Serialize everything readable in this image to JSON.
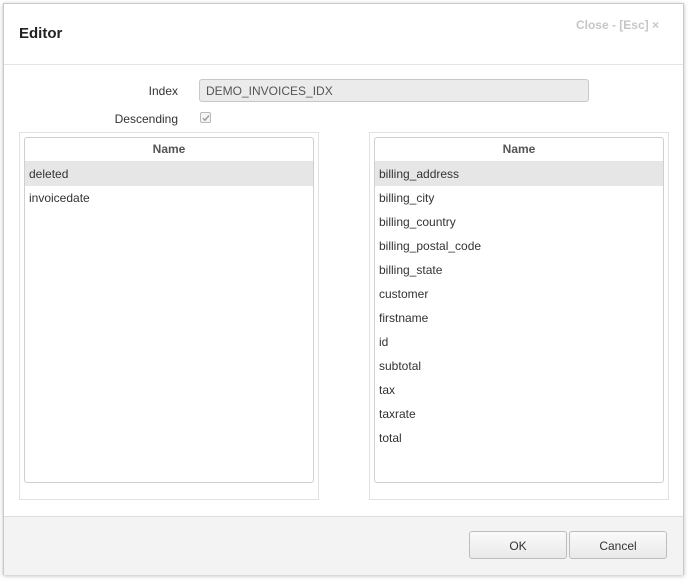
{
  "dialog": {
    "title": "Editor",
    "close_label": "Close - [Esc] ×"
  },
  "form": {
    "index_label": "Index",
    "index_value": "DEMO_INVOICES_IDX",
    "descending_label": "Descending",
    "descending_checked": true
  },
  "left_list": {
    "header": "Name",
    "items": [
      "deleted",
      "invoicedate"
    ],
    "selected_index": 0
  },
  "right_list": {
    "header": "Name",
    "items": [
      "billing_address",
      "billing_city",
      "billing_country",
      "billing_postal_code",
      "billing_state",
      "customer",
      "firstname",
      "id",
      "subtotal",
      "tax",
      "taxrate",
      "total"
    ],
    "selected_index": 0
  },
  "footer": {
    "ok_label": "OK",
    "cancel_label": "Cancel"
  }
}
